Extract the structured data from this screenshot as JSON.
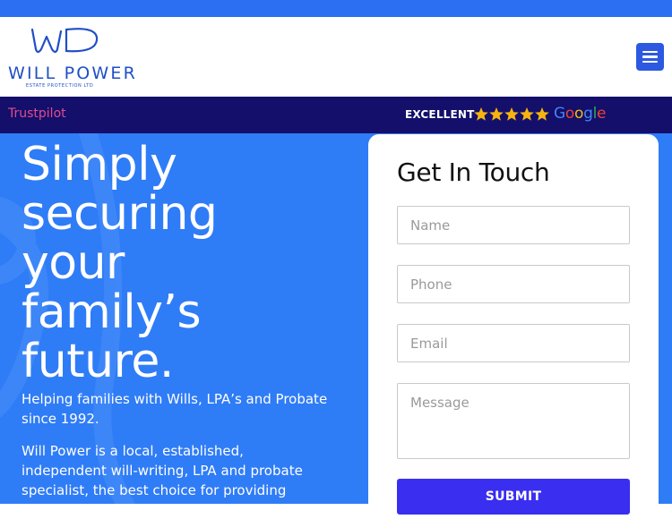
{
  "header": {
    "logo_title": "WILL POWER",
    "logo_subtitle": "ESTATE PROTECTION LTD",
    "menu_icon": "hamburger-icon"
  },
  "rating_bar": {
    "trustpilot_label": "Trustpilot",
    "excellent_label": "EXCELLENT",
    "star_rating": 5,
    "google_label": "Google"
  },
  "hero": {
    "headline_lines": [
      "Simply",
      "securing",
      "your",
      "family’s",
      "future."
    ],
    "lead": "Helping families with Wills, LPA’s and Probate since 1992.",
    "body": "Will Power is a local, established, independent will-writing, LPA and probate specialist, the best choice for providing"
  },
  "contact_form": {
    "title": "Get In Touch",
    "name_placeholder": "Name",
    "phone_placeholder": "Phone",
    "email_placeholder": "Email",
    "message_placeholder": "Message",
    "submit_label": "SUBMIT"
  },
  "colors": {
    "top_strip": "#2d6ff2",
    "brand_blue": "#1f4fc7",
    "rating_bar_bg": "#130f6b",
    "trustpilot_pink": "#e34b8f",
    "star_gold": "#f6b40e",
    "hero_bg": "#2f7cf7",
    "submit_bg": "#3a2ef0"
  }
}
